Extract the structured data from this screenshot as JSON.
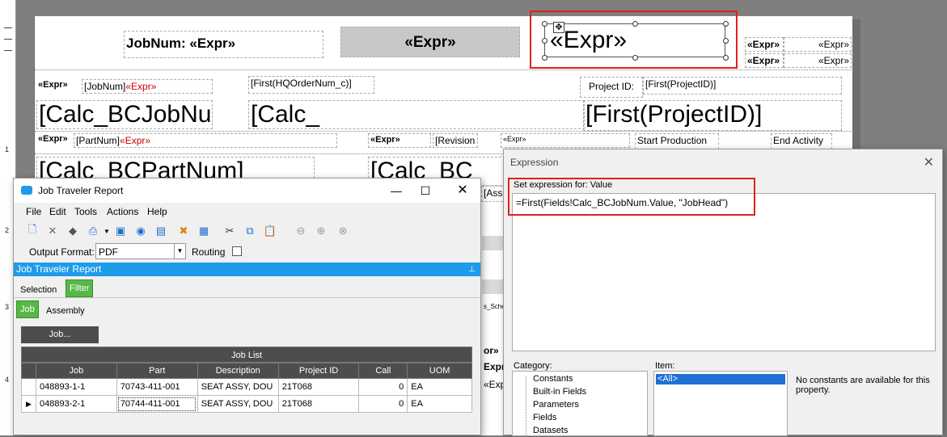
{
  "ruler": {
    "marks": [
      "1",
      "2",
      "3",
      "4"
    ]
  },
  "report": {
    "header_title": "JobNum: «Expr»",
    "gray_expr": "«Expr»",
    "selected_expr": "«Expr»",
    "right_expr_1a": "«Expr»",
    "right_expr_1b": "«Expr»",
    "right_expr_2a": "«Expr»",
    "right_expr_2b": "«Expr»",
    "row2_expr": "«Expr»",
    "row2_jobnum": "[JobNum]",
    "row2_jobnum_expr": "«Expr»",
    "row2_hq": "[First(HQOrderNum_c)]",
    "row2_project_label": "Project ID:",
    "row2_project_value": "[First(ProjectID)]",
    "row3_calc_job": "[Calc_BCJobNu",
    "row3_calc": "[Calc_",
    "row3_project": "[First(ProjectID)]",
    "row4_expr": "«Expr»",
    "row4_partnum": "[PartNum]",
    "row4_partnum_expr": "«Expr»",
    "row4_expr2": "«Expr»",
    "row4_revision": "[Revision",
    "row4_expr3": "«Expr»",
    "row4_start": "Start Production",
    "row4_end": "End Activity",
    "row5_calc_part": "[Calc_BCPartNum]",
    "row5_calc": "[Calc_BC",
    "frag_asse": "[Asse",
    "frag_schi": "s_Sche",
    "frag_or": "or»",
    "frag_expr": "Expr",
    "frag_expr2": "«Expr"
  },
  "job_window": {
    "title": "Job Traveler Report",
    "menu": [
      "File",
      "Edit",
      "Tools",
      "Actions",
      "Help"
    ],
    "output_format_label": "Output Format:",
    "output_format_value": "PDF",
    "routing_label": "Routing",
    "pane_title": "Job Traveler Report",
    "tabs": [
      "Selection",
      "Filter"
    ],
    "subtabs": [
      "Job",
      "Assembly"
    ],
    "job_button": "Job...",
    "list_caption": "Job List",
    "columns": [
      "Job",
      "Part",
      "Description",
      "Project ID",
      "Call",
      "UOM"
    ],
    "rows": [
      [
        "048893-1-1",
        "70743-411-001",
        "SEAT ASSY, DOU",
        "21T068",
        "0",
        "EA"
      ],
      [
        "048893-2-1",
        "70744-411-001",
        "SEAT ASSY, DOU",
        "21T068",
        "0",
        "EA"
      ]
    ]
  },
  "expression_dialog": {
    "title": "Expression",
    "set_label": "Set expression for: Value",
    "expression": "=First(Fields!Calc_BCJobNum.Value, \"JobHead\")",
    "category_label": "Category:",
    "item_label": "Item:",
    "categories": [
      "Constants",
      "Built-in Fields",
      "Parameters",
      "Fields",
      "Datasets"
    ],
    "selected_item": "<All>",
    "no_constants": "No constants are available for this property."
  },
  "colors": {
    "accent": "#1e9be9",
    "tab_active": "#57b848",
    "highlight": "#e02020"
  }
}
